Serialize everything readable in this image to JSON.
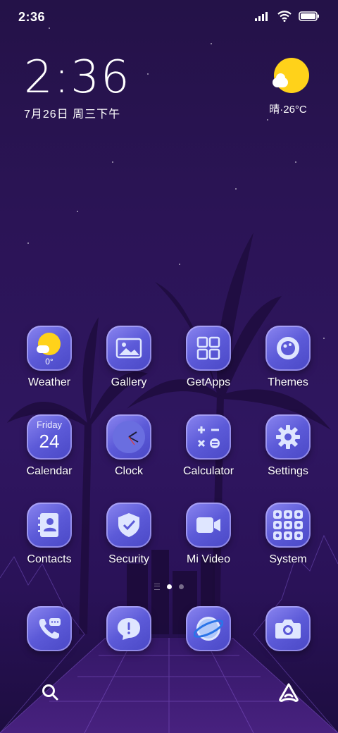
{
  "status_bar": {
    "time": "2:36",
    "icons": [
      "signal-icon",
      "wifi-icon",
      "battery-icon"
    ]
  },
  "clock_widget": {
    "time": "2:36",
    "date": "7月26日 周三下午"
  },
  "weather_widget": {
    "icon": "sunny-cloud-icon",
    "text": "晴·26°C"
  },
  "calendar_icon": {
    "weekday": "Friday",
    "day": "24"
  },
  "weather_app_icon": {
    "temp": "0°"
  },
  "apps": [
    {
      "label": "Weather",
      "icon": "weather-icon"
    },
    {
      "label": "Gallery",
      "icon": "image-icon"
    },
    {
      "label": "GetApps",
      "icon": "grid-icon"
    },
    {
      "label": "Themes",
      "icon": "palette-icon"
    },
    {
      "label": "Calendar",
      "icon": "calendar-icon"
    },
    {
      "label": "Clock",
      "icon": "clock-icon"
    },
    {
      "label": "Calculator",
      "icon": "calculator-icon"
    },
    {
      "label": "Settings",
      "icon": "gear-icon"
    },
    {
      "label": "Contacts",
      "icon": "contacts-icon"
    },
    {
      "label": "Security",
      "icon": "shield-icon"
    },
    {
      "label": "Mi Video",
      "icon": "video-icon"
    },
    {
      "label": "System",
      "icon": "folder-icon"
    }
  ],
  "dock": [
    {
      "icon": "phone-icon"
    },
    {
      "icon": "message-icon"
    },
    {
      "icon": "browser-icon"
    },
    {
      "icon": "camera-icon"
    }
  ],
  "page_indicator": {
    "pages": 2,
    "current": 1
  },
  "bottom_bar": {
    "left": "search-icon",
    "right": "assistant-icon"
  },
  "colors": {
    "accent": "#5c5ad8",
    "sun": "#ffd21a",
    "bg": "#2b1456"
  }
}
